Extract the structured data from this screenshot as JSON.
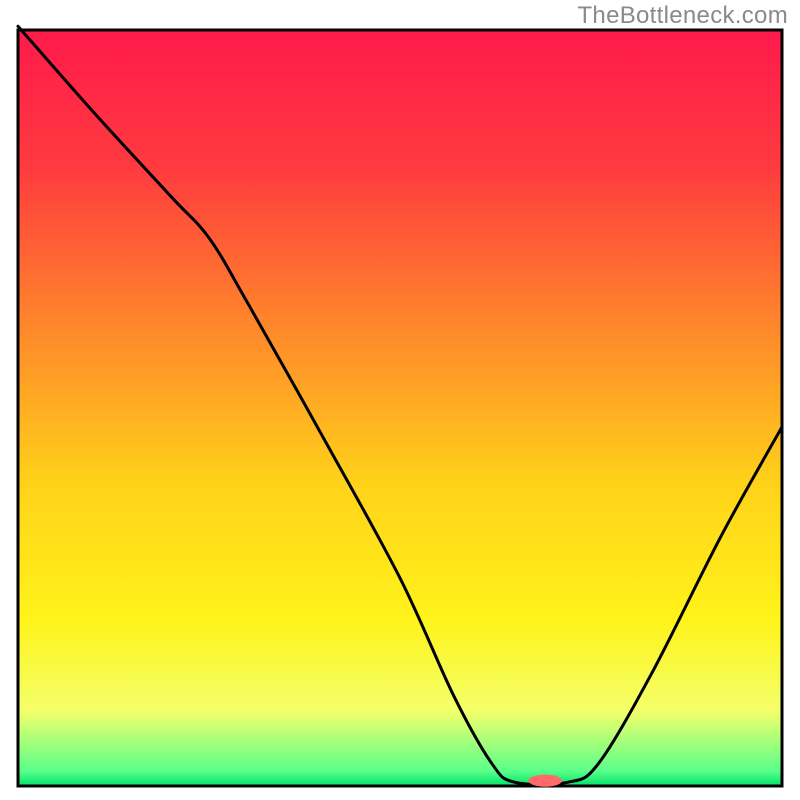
{
  "watermark": "TheBottleneck.com",
  "chart_data": {
    "type": "line",
    "title": "",
    "xlabel": "",
    "ylabel": "",
    "xlim": [
      0,
      100
    ],
    "ylim": [
      0,
      100
    ],
    "grid": false,
    "legend": false,
    "background_gradient_stops": [
      {
        "offset": 0,
        "color": "#ff1a4b"
      },
      {
        "offset": 18,
        "color": "#ff3a3f"
      },
      {
        "offset": 40,
        "color": "#ff8a2a"
      },
      {
        "offset": 60,
        "color": "#ffd21a"
      },
      {
        "offset": 78,
        "color": "#fff31a"
      },
      {
        "offset": 90,
        "color": "#f4ff6a"
      },
      {
        "offset": 98,
        "color": "#5bff8a"
      },
      {
        "offset": 100,
        "color": "#00e36a"
      }
    ],
    "curve_points": [
      {
        "x": 0.0,
        "y": 100.5
      },
      {
        "x": 10.0,
        "y": 89.0
      },
      {
        "x": 20.0,
        "y": 78.0
      },
      {
        "x": 25.0,
        "y": 72.5
      },
      {
        "x": 30.0,
        "y": 64.0
      },
      {
        "x": 40.0,
        "y": 46.0
      },
      {
        "x": 50.0,
        "y": 27.5
      },
      {
        "x": 57.0,
        "y": 12.0
      },
      {
        "x": 62.0,
        "y": 3.0
      },
      {
        "x": 65.0,
        "y": 0.5
      },
      {
        "x": 72.0,
        "y": 0.5
      },
      {
        "x": 76.0,
        "y": 3.0
      },
      {
        "x": 83.0,
        "y": 15.0
      },
      {
        "x": 92.0,
        "y": 33.0
      },
      {
        "x": 100.0,
        "y": 47.5
      }
    ],
    "marker": {
      "x": 69.0,
      "y": 0.7,
      "rx": 2.2,
      "ry": 0.8,
      "color": "#ff6b6b"
    },
    "frame_color": "#000000",
    "curve_color": "#000000"
  }
}
